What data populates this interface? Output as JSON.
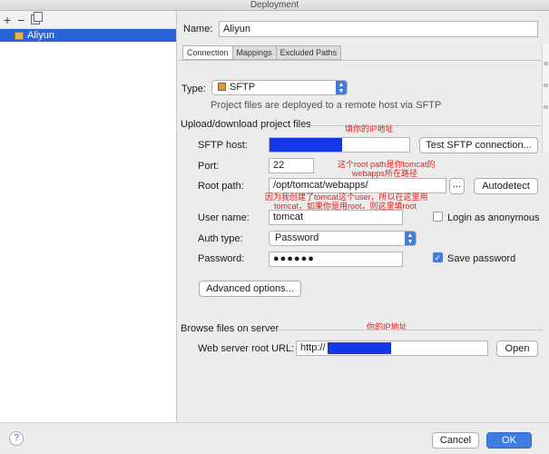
{
  "window": {
    "title": "Deployment"
  },
  "toolbar": {
    "add": "+",
    "remove": "−"
  },
  "servers": [
    {
      "name": "Aliyun"
    }
  ],
  "form": {
    "name_label": "Name:",
    "name_value": "Aliyun",
    "tabs": [
      "Connection",
      "Mappings",
      "Excluded Paths"
    ],
    "type_label": "Type:",
    "type_value": "SFTP",
    "type_hint": "Project files are deployed to a remote host via SFTP",
    "upload_section": "Upload/download project files",
    "sftp_host_label": "SFTP host:",
    "test_button": "Test SFTP connection...",
    "port_label": "Port:",
    "port_value": "22",
    "root_path_label": "Root path:",
    "root_path_value": "/opt/tomcat/webapps/",
    "browse_button": "...",
    "autodetect_button": "Autodetect",
    "user_name_label": "User name:",
    "user_name_value": "tomcat",
    "login_anon_label": "Login as anonymous",
    "auth_type_label": "Auth type:",
    "auth_type_value": "Password",
    "password_label": "Password:",
    "password_value": "●●●●●●",
    "save_password_label": "Save password",
    "advanced_button": "Advanced options...",
    "browse_section": "Browse files on server",
    "web_root_label": "Web server root URL:",
    "web_root_value": "http://",
    "open_button": "Open"
  },
  "annotations": {
    "host_note": "填你的IP地址",
    "root_note_1": "这个root path是你tomcat的",
    "root_note_2": "webapps所在路径",
    "user_note_1": "因为我创建了tomcat这个user，所以在这里用",
    "user_note_2": "tomcat，如果你是用root，则这里填root",
    "url_note": "你的IP地址"
  },
  "footer": {
    "help": "?",
    "cancel": "Cancel",
    "ok": "OK"
  },
  "colors": {
    "accent": "#3e7dde",
    "selection": "#2a63d6",
    "annotation": "#e0211b",
    "redaction": "#1438e6"
  }
}
